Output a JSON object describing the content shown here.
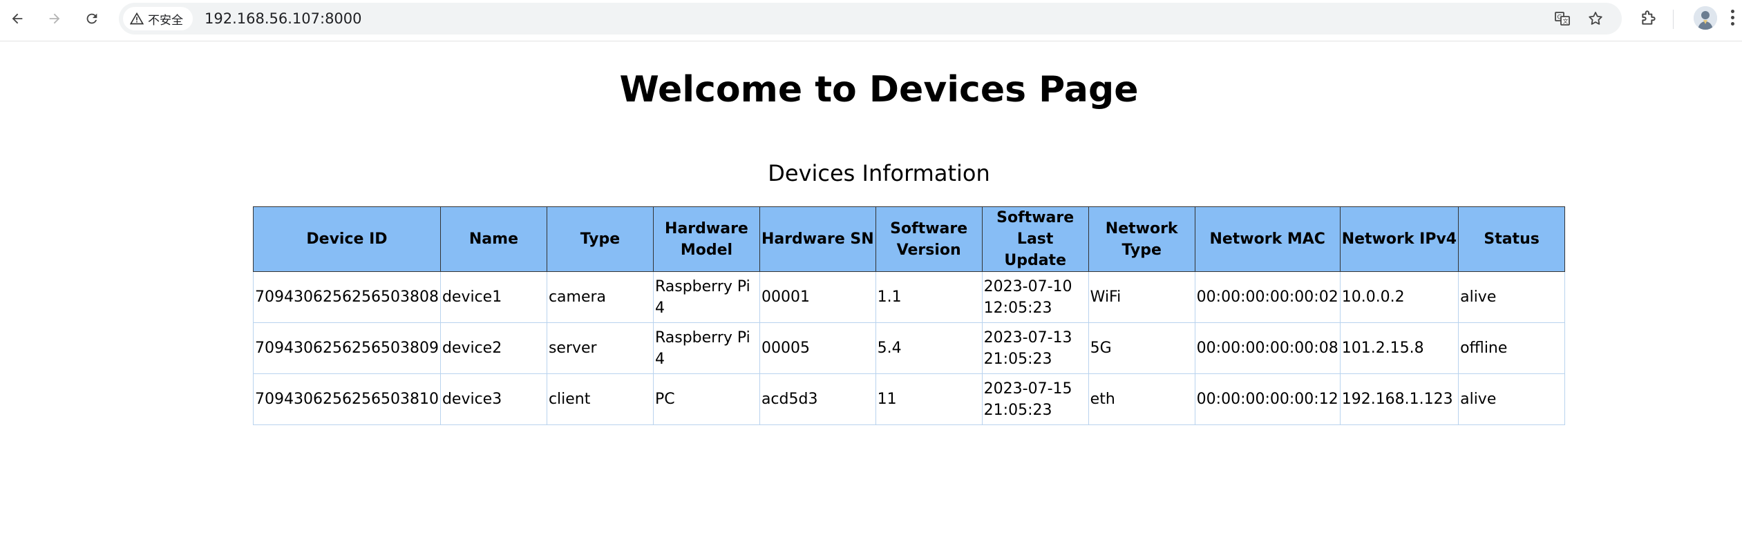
{
  "browser": {
    "security_label": "不安全",
    "url": "192.168.56.107:8000",
    "icons": [
      "back-icon",
      "forward-icon",
      "reload-icon",
      "warning-icon",
      "translate-icon",
      "star-icon",
      "extensions-icon",
      "profile-avatar",
      "menu-icon"
    ]
  },
  "page": {
    "title": "Welcome to Devices Page",
    "section_title": "Devices Information"
  },
  "table": {
    "header_color": "#87bdf5",
    "columns": [
      "Device ID",
      "Name",
      "Type",
      "Hardware Model",
      "Hardware SN",
      "Software Version",
      "Software Last Update",
      "Network Type",
      "Network MAC",
      "Network IPv4",
      "Status"
    ],
    "rows": [
      [
        "7094306256256503808",
        "device1",
        "camera",
        "Raspberry Pi 4",
        "00001",
        "1.1",
        "2023-07-10 12:05:23",
        "WiFi",
        "00:00:00:00:00:02",
        "10.0.0.2",
        "alive"
      ],
      [
        "7094306256256503809",
        "device2",
        "server",
        "Raspberry Pi 4",
        "00005",
        "5.4",
        "2023-07-13 21:05:23",
        "5G",
        "00:00:00:00:00:08",
        "101.2.15.8",
        "offline"
      ],
      [
        "7094306256256503810",
        "device3",
        "client",
        "PC",
        "acd5d3",
        "11",
        "2023-07-15 21:05:23",
        "eth",
        "00:00:00:00:00:12",
        "192.168.1.123",
        "alive"
      ]
    ]
  }
}
